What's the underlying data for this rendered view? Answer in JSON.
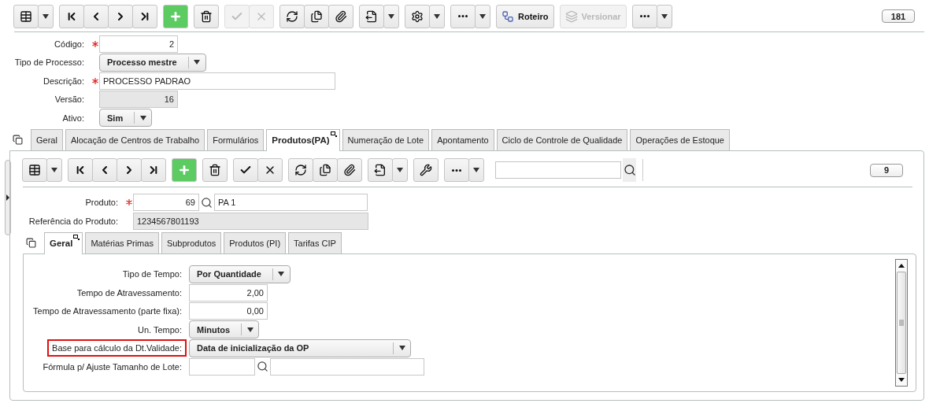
{
  "toolbar": {
    "groups": [
      {
        "items": [
          {
            "kind": "grid",
            "disabled": false
          },
          {
            "kind": "caret",
            "disabled": false
          }
        ]
      },
      {
        "items": [
          {
            "kind": "first",
            "disabled": false
          },
          {
            "kind": "previous",
            "disabled": false
          },
          {
            "kind": "next",
            "disabled": false
          },
          {
            "kind": "last",
            "disabled": false
          }
        ]
      },
      {
        "items": [
          {
            "kind": "add",
            "disabled": false
          }
        ]
      },
      {
        "items": [
          {
            "kind": "delete",
            "disabled": false
          }
        ]
      },
      {
        "items": [
          {
            "kind": "confirm",
            "disabled": true
          },
          {
            "kind": "cancel",
            "disabled": true
          }
        ]
      },
      {
        "items": [
          {
            "kind": "refresh",
            "disabled": false
          },
          {
            "kind": "duplicate",
            "disabled": false
          },
          {
            "kind": "attach",
            "disabled": false
          }
        ]
      },
      {
        "items": [
          {
            "kind": "export",
            "disabled": false
          },
          {
            "kind": "caret",
            "disabled": false
          }
        ]
      },
      {
        "items": [
          {
            "kind": "settings",
            "disabled": false
          },
          {
            "kind": "caret",
            "disabled": false
          }
        ]
      },
      {
        "items": [
          {
            "kind": "more",
            "disabled": false
          },
          {
            "kind": "caret",
            "disabled": false
          }
        ]
      },
      {
        "items": [
          {
            "kind": "route",
            "label": "Roteiro",
            "disabled": false
          }
        ]
      },
      {
        "items": [
          {
            "kind": "version",
            "label": "Versionar",
            "disabled": true
          }
        ]
      },
      {
        "items": [
          {
            "kind": "more",
            "disabled": false
          },
          {
            "kind": "caret",
            "disabled": false
          }
        ]
      }
    ],
    "count": "181"
  },
  "form": {
    "fields": [
      {
        "label": "Código:",
        "kind": "number",
        "required": true,
        "value": "2"
      },
      {
        "label": "Tipo de Processo:",
        "kind": "select",
        "required": false,
        "value": "Processo mestre"
      },
      {
        "label": "Descrição:",
        "kind": "text",
        "required": true,
        "value": "PROCESSO PADRAO"
      },
      {
        "label": "Versão:",
        "kind": "readonly_number",
        "required": false,
        "value": "16"
      },
      {
        "label": "Ativo:",
        "kind": "select",
        "required": false,
        "value": "Sim"
      }
    ]
  },
  "tabs": [
    {
      "label": "Geral",
      "selected": false
    },
    {
      "label": "Alocação de Centros de Trabalho",
      "selected": false
    },
    {
      "label": "Formulários",
      "selected": false
    },
    {
      "label": "Produtos(PA)",
      "selected": true
    },
    {
      "label": "Numeração de Lote",
      "selected": false
    },
    {
      "label": "Apontamento",
      "selected": false
    },
    {
      "label": "Ciclo de Controle de Qualidade",
      "selected": false
    },
    {
      "label": "Operações de Estoque",
      "selected": false
    }
  ],
  "panel": {
    "toolbar": {
      "groups": [
        {
          "items": [
            {
              "kind": "grid",
              "disabled": false
            },
            {
              "kind": "caret",
              "disabled": false
            }
          ]
        },
        {
          "items": [
            {
              "kind": "first",
              "disabled": false
            },
            {
              "kind": "previous",
              "disabled": false
            },
            {
              "kind": "next",
              "disabled": false
            },
            {
              "kind": "last",
              "disabled": false
            }
          ]
        },
        {
          "items": [
            {
              "kind": "add",
              "disabled": false
            }
          ]
        },
        {
          "items": [
            {
              "kind": "delete",
              "disabled": false
            }
          ]
        },
        {
          "items": [
            {
              "kind": "confirm",
              "disabled": false
            },
            {
              "kind": "cancel",
              "disabled": false
            }
          ]
        },
        {
          "items": [
            {
              "kind": "refresh",
              "disabled": false
            },
            {
              "kind": "duplicate",
              "disabled": false
            },
            {
              "kind": "attach",
              "disabled": false
            }
          ]
        },
        {
          "items": [
            {
              "kind": "export",
              "disabled": false
            },
            {
              "kind": "caret",
              "disabled": false
            }
          ]
        },
        {
          "items": [
            {
              "kind": "tools",
              "disabled": false
            }
          ]
        },
        {
          "items": [
            {
              "kind": "more",
              "disabled": false
            },
            {
              "kind": "caret",
              "disabled": false
            }
          ]
        }
      ],
      "count": "9"
    },
    "fields": [
      {
        "label": "Produto:",
        "kind": "lookup",
        "required": true,
        "code": "69",
        "description": "PA 1"
      },
      {
        "label": "Referência do Produto:",
        "kind": "readonly_text",
        "required": false,
        "value": "1234567801193"
      }
    ],
    "tabs": [
      {
        "label": "Geral",
        "selected": true
      },
      {
        "label": "Matérias Primas",
        "selected": false
      },
      {
        "label": "Subprodutos",
        "selected": false
      },
      {
        "label": "Produtos (PI)",
        "selected": false
      },
      {
        "label": "Tarifas CIP",
        "selected": false
      }
    ],
    "detail": [
      {
        "label": "Tipo de Tempo:",
        "kind": "select",
        "highlighted": false,
        "value": "Por Quantidade"
      },
      {
        "label": "Tempo de Atravessamento:",
        "kind": "number",
        "highlighted": false,
        "value": "2,00"
      },
      {
        "label": "Tempo de Atravessamento (parte fixa):",
        "kind": "number",
        "highlighted": false,
        "value": "0,00"
      },
      {
        "label": "Un. Tempo:",
        "kind": "select",
        "highlighted": false,
        "value": "Minutos"
      },
      {
        "label": "Base para cálculo da Dt.Validade:",
        "kind": "long_select",
        "highlighted": true,
        "value": "Data de inicialização da OP"
      },
      {
        "label": "Fórmula p/ Ajuste Tamanho de Lote:",
        "kind": "lookup",
        "highlighted": false
      }
    ]
  }
}
